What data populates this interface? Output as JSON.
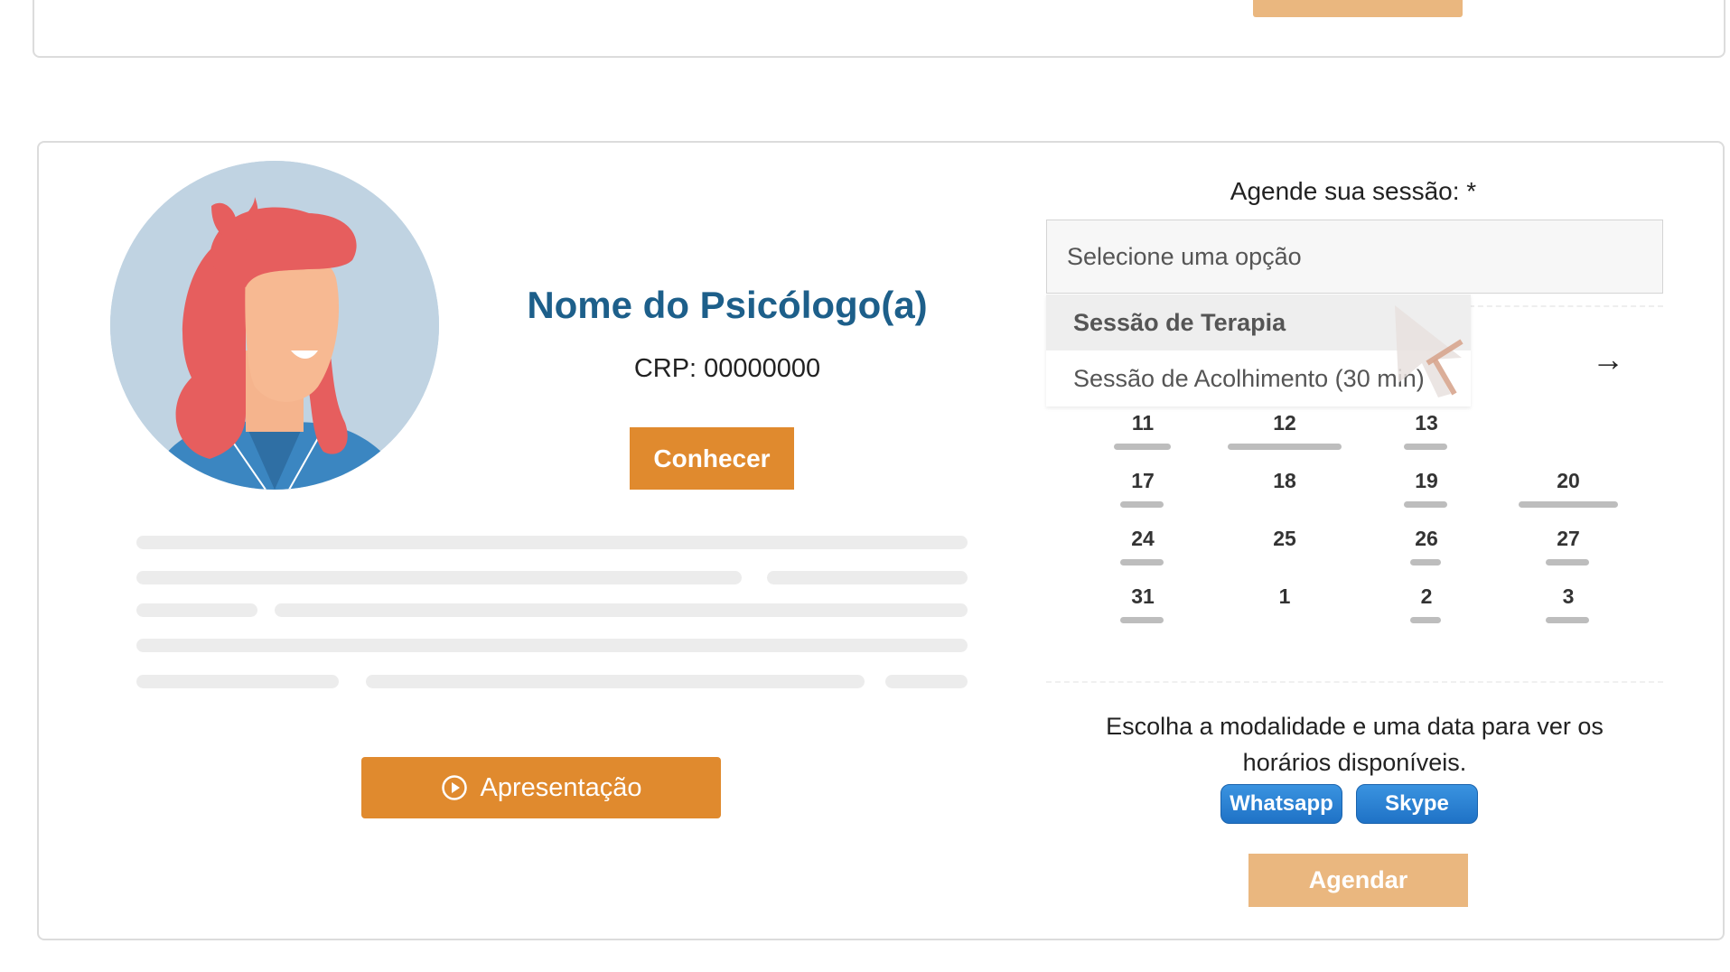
{
  "profile": {
    "name": "Nome do Psicólogo(a)",
    "crp": "CRP: 00000000",
    "conhecer_label": "Conhecer",
    "apresentacao_label": "Apresentação",
    "avatar_icon": "woman-avatar-illustration"
  },
  "booking": {
    "label": "Agende sua sessão: *",
    "select_placeholder": "Selecione uma opção",
    "options": [
      "Sessão de Terapia",
      "Sessão de Acolhimento (30 min)"
    ],
    "next_icon": "arrow-right-icon",
    "calendar": {
      "rows": [
        [
          "11",
          "12",
          "13",
          ""
        ],
        [
          "17",
          "18",
          "19",
          "20"
        ],
        [
          "24",
          "25",
          "26",
          "27"
        ],
        [
          "31",
          "1",
          "2",
          "3"
        ]
      ]
    },
    "info_text_line1": "Escolha a modalidade e uma data para ver os",
    "info_text_line2": "horários disponíveis.",
    "whatsapp_label": "Whatsapp",
    "skype_label": "Skype",
    "agendar_label": "Agendar"
  },
  "colors": {
    "accent_orange": "#e08a2e",
    "light_orange": "#eab77f",
    "title_blue": "#1d5f8a",
    "pill_blue": "#2a82d6"
  }
}
